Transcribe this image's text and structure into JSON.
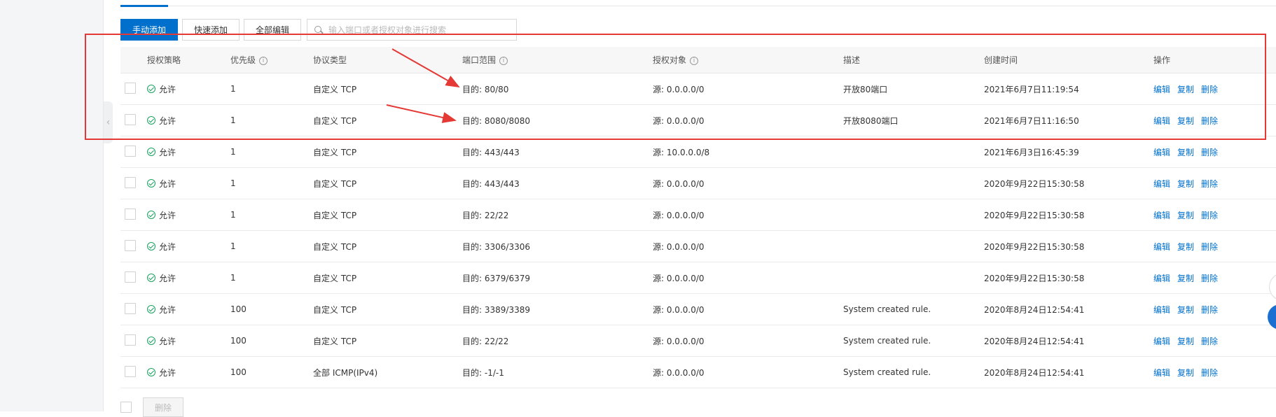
{
  "toolbar": {
    "add_manual": "手动添加",
    "add_quick": "快速添加",
    "edit_all": "全部编辑",
    "search_placeholder": "输入端口或者授权对象进行搜索"
  },
  "table": {
    "headers": {
      "policy": "授权策略",
      "priority": "优先级",
      "protocol": "协议类型",
      "port": "端口范围",
      "object": "授权对象",
      "desc": "描述",
      "time": "创建时间",
      "ops": "操作"
    },
    "rows": [
      {
        "policy": "允许",
        "priority": "1",
        "protocol": "自定义 TCP",
        "port": "目的: 80/80",
        "object": "源: 0.0.0.0/0",
        "desc": "开放80端口",
        "time": "2021年6月7日11:19:54",
        "edit": "编辑",
        "copy": "复制",
        "delete": "删除"
      },
      {
        "policy": "允许",
        "priority": "1",
        "protocol": "自定义 TCP",
        "port": "目的: 8080/8080",
        "object": "源: 0.0.0.0/0",
        "desc": "开放8080端口",
        "time": "2021年6月7日11:16:50",
        "edit": "编辑",
        "copy": "复制",
        "delete": "删除"
      },
      {
        "policy": "允许",
        "priority": "1",
        "protocol": "自定义 TCP",
        "port": "目的: 443/443",
        "object": "源: 10.0.0.0/8",
        "desc": "",
        "time": "2021年6月3日16:45:39",
        "edit": "编辑",
        "copy": "复制",
        "delete": "删除"
      },
      {
        "policy": "允许",
        "priority": "1",
        "protocol": "自定义 TCP",
        "port": "目的: 443/443",
        "object": "源: 0.0.0.0/0",
        "desc": "",
        "time": "2020年9月22日15:30:58",
        "edit": "编辑",
        "copy": "复制",
        "delete": "删除"
      },
      {
        "policy": "允许",
        "priority": "1",
        "protocol": "自定义 TCP",
        "port": "目的: 22/22",
        "object": "源: 0.0.0.0/0",
        "desc": "",
        "time": "2020年9月22日15:30:58",
        "edit": "编辑",
        "copy": "复制",
        "delete": "删除"
      },
      {
        "policy": "允许",
        "priority": "1",
        "protocol": "自定义 TCP",
        "port": "目的: 3306/3306",
        "object": "源: 0.0.0.0/0",
        "desc": "",
        "time": "2020年9月22日15:30:58",
        "edit": "编辑",
        "copy": "复制",
        "delete": "删除"
      },
      {
        "policy": "允许",
        "priority": "1",
        "protocol": "自定义 TCP",
        "port": "目的: 6379/6379",
        "object": "源: 0.0.0.0/0",
        "desc": "",
        "time": "2020年9月22日15:30:58",
        "edit": "编辑",
        "copy": "复制",
        "delete": "删除"
      },
      {
        "policy": "允许",
        "priority": "100",
        "protocol": "自定义 TCP",
        "port": "目的: 3389/3389",
        "object": "源: 0.0.0.0/0",
        "desc": "System created rule.",
        "time": "2020年8月24日12:54:41",
        "edit": "编辑",
        "copy": "复制",
        "delete": "删除"
      },
      {
        "policy": "允许",
        "priority": "100",
        "protocol": "自定义 TCP",
        "port": "目的: 22/22",
        "object": "源: 0.0.0.0/0",
        "desc": "System created rule.",
        "time": "2020年8月24日12:54:41",
        "edit": "编辑",
        "copy": "复制",
        "delete": "删除"
      },
      {
        "policy": "允许",
        "priority": "100",
        "protocol": "全部 ICMP(IPv4)",
        "port": "目的: -1/-1",
        "object": "源: 0.0.0.0/0",
        "desc": "System created rule.",
        "time": "2020年8月24日12:54:41",
        "edit": "编辑",
        "copy": "复制",
        "delete": "删除"
      }
    ]
  },
  "footer": {
    "delete_label": "删除"
  },
  "colors": {
    "primary": "#0070cc",
    "allow_green": "#19a15f",
    "annotation_red": "#e53935"
  }
}
